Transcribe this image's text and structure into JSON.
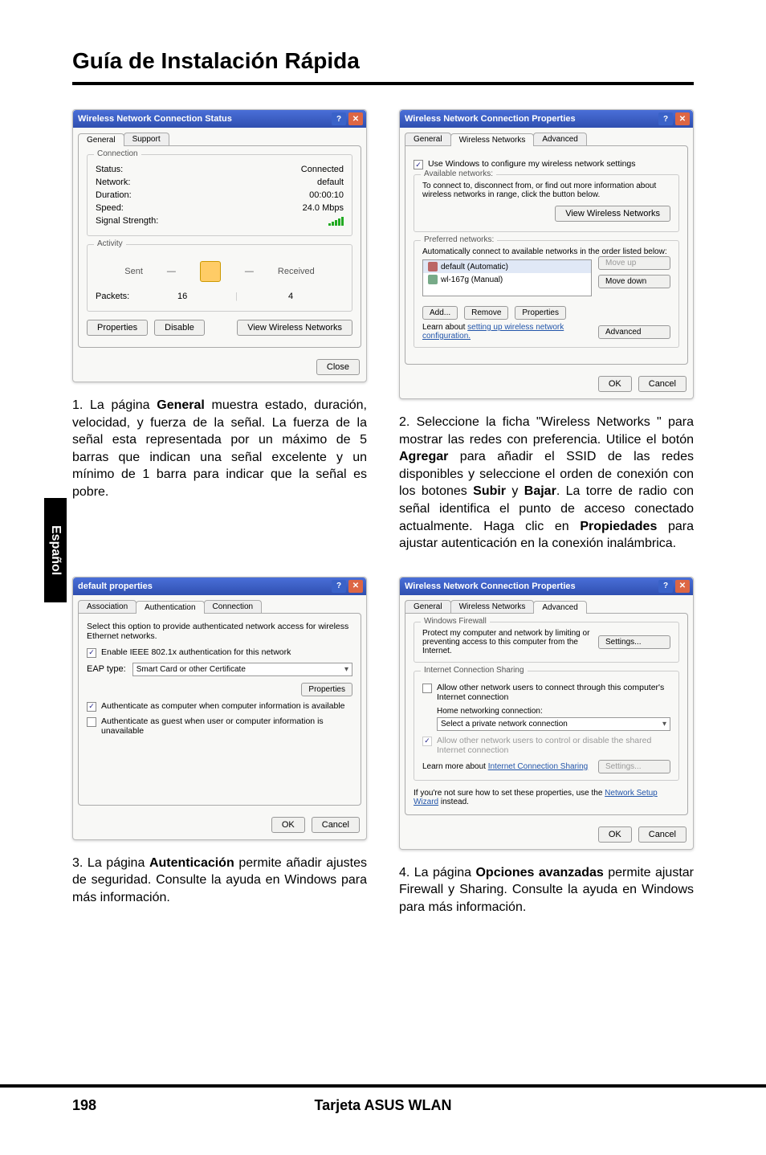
{
  "page": {
    "title": "Guía de Instalación Rápida",
    "language_tab": "Español",
    "number": "198",
    "footer_title": "Tarjeta ASUS WLAN"
  },
  "dialog1": {
    "title": "Wireless Network Connection Status",
    "tab_general": "General",
    "tab_support": "Support",
    "section_connection": "Connection",
    "status_label": "Status:",
    "status_value": "Connected",
    "network_label": "Network:",
    "network_value": "default",
    "duration_label": "Duration:",
    "duration_value": "00:00:10",
    "speed_label": "Speed:",
    "speed_value": "24.0 Mbps",
    "signal_label": "Signal Strength:",
    "section_activity": "Activity",
    "sent_label": "Sent",
    "received_label": "Received",
    "packets_label": "Packets:",
    "packets_sent": "16",
    "packets_received": "4",
    "btn_properties": "Properties",
    "btn_disable": "Disable",
    "btn_view": "View Wireless Networks",
    "btn_close": "Close"
  },
  "dialog2": {
    "title": "Wireless Network Connection Properties",
    "tab_general": "General",
    "tab_wireless": "Wireless Networks",
    "tab_advanced": "Advanced",
    "use_windows": "Use Windows to configure my wireless network settings",
    "available_section": "Available networks:",
    "available_text": "To connect to, disconnect from, or find out more information about wireless networks in range, click the button below.",
    "btn_view": "View Wireless Networks",
    "preferred_section": "Preferred networks:",
    "preferred_text": "Automatically connect to available networks in the order listed below:",
    "item1": "default (Automatic)",
    "item2": "wl-167g (Manual)",
    "btn_move_up": "Move up",
    "btn_move_down": "Move down",
    "btn_add": "Add...",
    "btn_remove": "Remove",
    "btn_properties": "Properties",
    "learn_text": "Learn about ",
    "learn_link": "setting up wireless network configuration.",
    "btn_advanced": "Advanced",
    "btn_ok": "OK",
    "btn_cancel": "Cancel"
  },
  "dialog3": {
    "title": "default properties",
    "tab_assoc": "Association",
    "tab_auth": "Authentication",
    "tab_conn": "Connection",
    "auth_text": "Select this option to provide authenticated network access for wireless Ethernet networks.",
    "enable_8021x": "Enable IEEE 802.1x authentication for this network",
    "eap_type_label": "EAP type:",
    "eap_type_value": "Smart Card or other Certificate",
    "btn_properties": "Properties",
    "auth_as_computer": "Authenticate as computer when computer information is available",
    "auth_as_guest": "Authenticate as guest when user or computer information is unavailable",
    "btn_ok": "OK",
    "btn_cancel": "Cancel"
  },
  "dialog4": {
    "title": "Wireless Network Connection Properties",
    "tab_general": "General",
    "tab_wireless": "Wireless Networks",
    "tab_advanced": "Advanced",
    "fw_section": "Windows Firewall",
    "fw_text": "Protect my computer and network by limiting or preventing access to this computer from the Internet.",
    "btn_settings": "Settings...",
    "ics_section": "Internet Connection Sharing",
    "ics_allow": "Allow other network users to connect through this computer's Internet connection",
    "home_label": "Home networking connection:",
    "home_value": "Select a private network connection",
    "ics_control": "Allow other network users to control or disable the shared Internet connection",
    "learn_text": "Learn more about ",
    "learn_link": "Internet Connection Sharing",
    "btn_settings2": "Settings...",
    "wizard_text": "If you're not sure how to set these properties, use the ",
    "wizard_link": "Network Setup Wizard",
    "wizard_text2": " instead.",
    "btn_ok": "OK",
    "btn_cancel": "Cancel"
  },
  "captions": {
    "c1": "1. La página <b>General</b> muestra estado, duración, velocidad, y fuerza de la señal. La fuerza de la señal esta representada por un máximo de 5 barras que indican una señal excelente y un mínimo de 1 barra para indicar que la señal es pobre.",
    "c2": "2. Seleccione la ficha \"Wireless Networks \" para mostrar las redes con preferencia. Utilice el botón <b>Agregar</b> para añadir el SSID de las redes disponibles y seleccione el orden de conexión con los botones <b>Subir</b> y <b>Bajar</b>. La torre de radio con señal identifica el punto de acceso conectado actualmente. Haga clic en <b>Propiedades</b> para ajustar autenticación en la conexión inalámbrica.",
    "c3": "3. La página <b>Autenticación</b> permite añadir ajustes de seguridad. Consulte la ayuda en Windows para más información.",
    "c4": "4. La página <b>Opciones avanzadas</b> permite ajustar Firewall y Sharing. Consulte la ayuda en Windows para más información."
  }
}
